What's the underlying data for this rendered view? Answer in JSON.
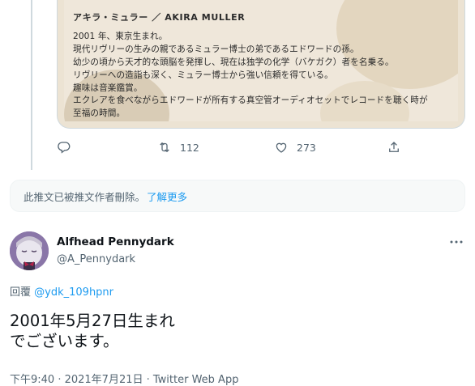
{
  "media_card": {
    "profile_name": "アキラ・ミュラー ／ AKIRA MULLER",
    "profile_lines": [
      "2001 年、東京生まれ。",
      "現代リヴリーの生みの親であるミュラー博士の弟であるエドワードの孫。",
      "幼少の頃から天才的な頭脳を発揮し、現在は独学の化学（バケガク）者を名乗る。",
      "リヴリーへの造詣も深く、ミュラー博士から強い信頼を得ている。",
      "趣味は音楽鑑賞。",
      "エクレアを食べながらエドワードが所有する真空管オーディオセットでレコードを聴く時が",
      "至福の時間。"
    ]
  },
  "tweet_actions": {
    "retweet_count": "112",
    "like_count": "273"
  },
  "notice": {
    "text": "此推文已被推文作者刪除。",
    "link": "了解更多"
  },
  "reply_tweet": {
    "display_name": "Alfhead Pennydark",
    "handle": "@A_Pennydark",
    "replying_label": "回覆",
    "replying_to": "@ydk_109hpnr",
    "body_line_1": "2001年5月27日生まれ",
    "body_line_2": "でございます。",
    "timestamp": "下午9:40 · 2021年7月21日 · Twitter Web App"
  },
  "colors": {
    "link": "#1d9bf0",
    "secondary_text": "#536471",
    "border": "#cfd9de"
  }
}
